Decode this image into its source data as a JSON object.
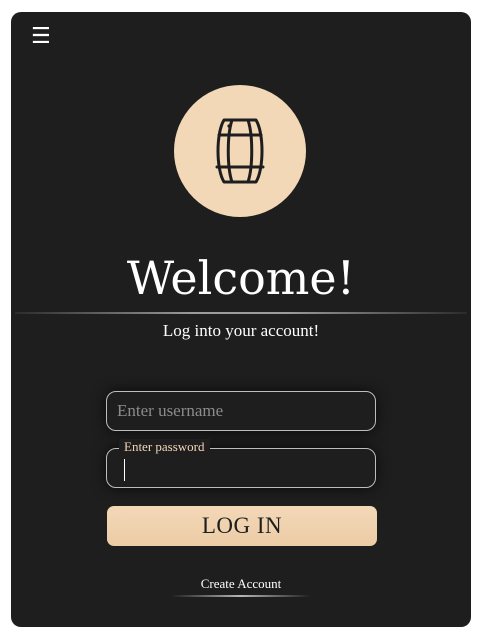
{
  "header": {
    "menu_icon": "hamburger-menu-icon",
    "menu_glyph": "☰"
  },
  "logo": {
    "icon": "barrel-icon",
    "circle_color": "#f3d8b8"
  },
  "welcome": {
    "title": "Welcome!",
    "subtitle": "Log into your account!"
  },
  "form": {
    "username_placeholder": "Enter username",
    "username_value": "",
    "password_label": "Enter password",
    "password_value": "",
    "login_label": "LOG IN",
    "create_account_label": "Create Account"
  },
  "colors": {
    "background": "#1e1e1e",
    "accent": "#f3d8b8",
    "text": "#ffffff"
  }
}
